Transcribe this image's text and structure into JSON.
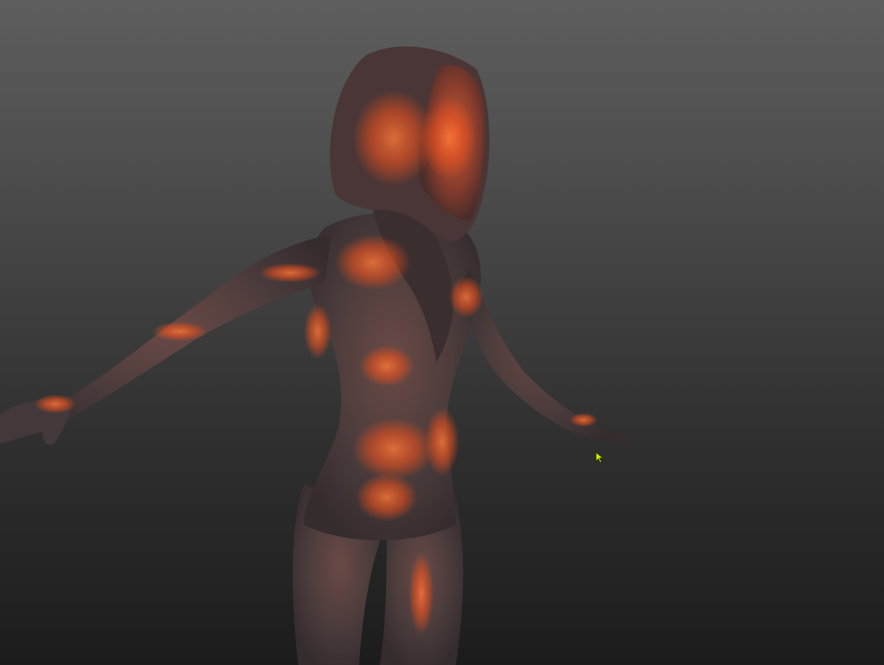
{
  "viewport": {
    "background_top": "#5e5e5e",
    "background_bottom": "#1c1c1c"
  },
  "model": {
    "base_color": "#4a3a3a",
    "glow_color": "#e8501f",
    "highlight_color": "#ff7a3a"
  },
  "cursor": {
    "icon": "arrow-cursor-icon",
    "color": "#c8f000"
  }
}
